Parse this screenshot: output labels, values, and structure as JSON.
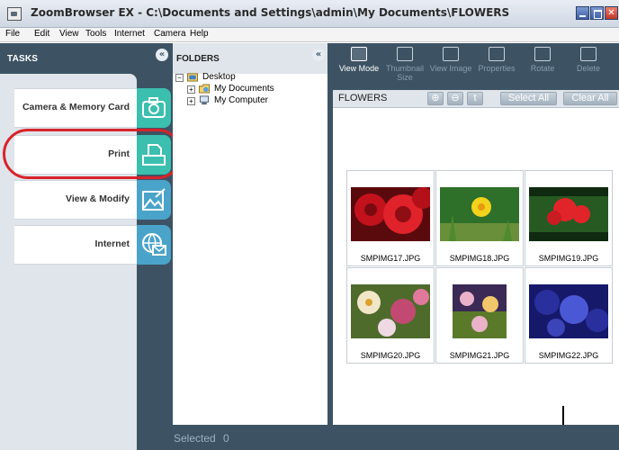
{
  "window": {
    "title": "ZoomBrowser EX  -  C:\\Documents and Settings\\admin\\My Documents\\FLOWERS"
  },
  "menu": [
    "File",
    "Edit",
    "View",
    "Tools",
    "Internet",
    "Camera",
    "Help"
  ],
  "tasks": {
    "header": "TASKS",
    "items": [
      {
        "label": "Camera & Memory Card",
        "icon": "camera-icon",
        "color": "#3bbfae"
      },
      {
        "label": "Print",
        "icon": "printer-icon",
        "color": "#3bbfae"
      },
      {
        "label": "View & Modify",
        "icon": "picture-edit-icon",
        "color": "#4aa3c9"
      },
      {
        "label": "Internet",
        "icon": "globe-mail-icon",
        "color": "#4aa3c9"
      }
    ],
    "highlighted": "Print",
    "highlight_color": "#d8232a"
  },
  "folders": {
    "header": "FOLDERS",
    "tree": [
      {
        "label": "Desktop",
        "expander": "⊟"
      },
      {
        "label": "My Documents",
        "expander": "⊞"
      },
      {
        "label": "My Computer",
        "expander": "⊞"
      }
    ]
  },
  "toolbar": {
    "buttons": [
      {
        "label": "View Mode",
        "active": true
      },
      {
        "label": "Thumbnail Size",
        "active": false
      },
      {
        "label": "View Image",
        "active": false
      },
      {
        "label": "Properties",
        "active": false
      },
      {
        "label": "Rotate",
        "active": false
      },
      {
        "label": "Delete",
        "active": false
      }
    ]
  },
  "pathbar": {
    "folder": "FLOWERS",
    "zoom_in": "⊕",
    "zoom_out": "⊖",
    "up": "t",
    "select_all": "Select All",
    "clear_all": "Clear All"
  },
  "thumbnails": [
    {
      "name": "SMPIMG17.JPG",
      "colors": [
        "#b3101a",
        "#e0222a",
        "#5a0a0d"
      ]
    },
    {
      "name": "SMPIMG18.JPG",
      "colors": [
        "#f3d21b",
        "#2e6f2a",
        "#6a8f3a"
      ]
    },
    {
      "name": "SMPIMG19.JPG",
      "colors": [
        "#e1242a",
        "#265a22",
        "#0f2a10"
      ]
    },
    {
      "name": "SMPIMG20.JPG",
      "colors": [
        "#f1e6c8",
        "#c24a72",
        "#4f6b2c"
      ]
    },
    {
      "name": "SMPIMG21.JPG",
      "colors": [
        "#e9b2c8",
        "#5a7a2a",
        "#3a2a55"
      ]
    },
    {
      "name": "SMPIMG22.JPG",
      "colors": [
        "#2a2f9e",
        "#4b58d6",
        "#16196a"
      ]
    }
  ],
  "status": {
    "selected_label": "Selected",
    "selected_count": "0"
  }
}
